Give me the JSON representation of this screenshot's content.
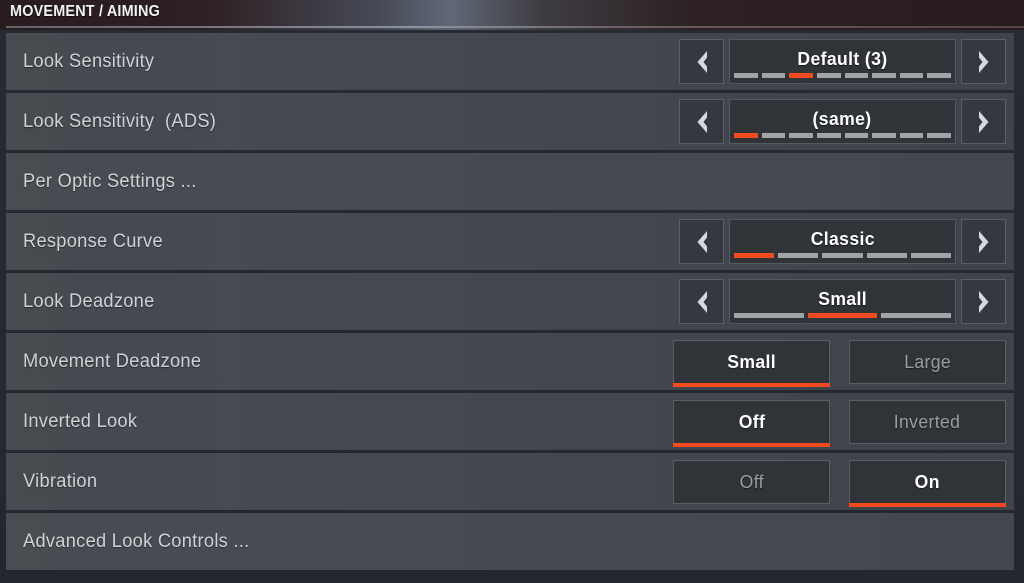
{
  "header": {
    "title": "MOVEMENT / AIMING"
  },
  "accent_color": "#f04a1e",
  "rows": [
    {
      "label": "Look Sensitivity",
      "control": "stepper",
      "value": "Default (3)",
      "segments": 8,
      "active_segment": 3,
      "left_arrow": "chevron-left-icon",
      "right_arrow": "chevron-right-icon"
    },
    {
      "label": "Look Sensitivity  (ADS)",
      "control": "stepper",
      "value": "(same)",
      "segments": 8,
      "active_segment": 1,
      "left_arrow": "chevron-left-icon",
      "right_arrow": "chevron-right-icon"
    },
    {
      "label": "Per Optic Settings ...",
      "control": "none"
    },
    {
      "label": "Response Curve",
      "control": "stepper",
      "value": "Classic",
      "segments": 5,
      "active_segment": 1,
      "left_arrow": "chevron-left-icon",
      "right_arrow": "chevron-right-icon"
    },
    {
      "label": "Look Deadzone",
      "control": "stepper",
      "value": "Small",
      "segments": 3,
      "active_segment": 2,
      "left_arrow": "chevron-left-icon",
      "right_arrow": "chevron-right-icon"
    },
    {
      "label": "Movement Deadzone",
      "control": "toggle",
      "options": [
        "Small",
        "Large"
      ],
      "selected_index": 0
    },
    {
      "label": "Inverted Look",
      "control": "toggle",
      "options": [
        "Off",
        "Inverted"
      ],
      "selected_index": 0
    },
    {
      "label": "Vibration",
      "control": "toggle",
      "options": [
        "Off",
        "On"
      ],
      "selected_index": 1
    },
    {
      "label": "Advanced Look Controls ...",
      "control": "none"
    }
  ]
}
